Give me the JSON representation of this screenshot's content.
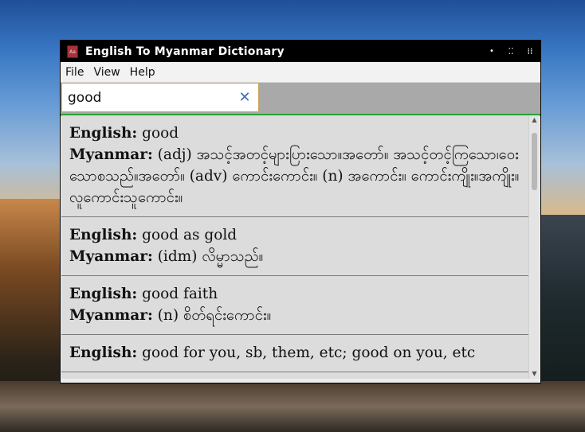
{
  "window": {
    "title": "English To Myanmar Dictionary",
    "app_icon_label": "Aa"
  },
  "menu": [
    "File",
    "View",
    "Help"
  ],
  "search": {
    "value": "good",
    "placeholder": ""
  },
  "labels": {
    "english": "English:",
    "myanmar": "Myanmar:"
  },
  "results": [
    {
      "english": "good",
      "myanmar": "(adj) အသင့်အတင့်များပြားသော။အတော်။ အသင့်တင့်ကြသော၊ဝေးသောစသည်။အတော်။ (adv) ကောင်းကောင်း။ (n) အကောင်း။ ကောင်းကျိုး။အကျိုး။ လူကောင်းသူကောင်း။"
    },
    {
      "english": "good as gold",
      "myanmar": "(idm) လိမ္မာသည်။"
    },
    {
      "english": "good faith",
      "myanmar": "(n) စိတ်ရင်းကောင်း။"
    },
    {
      "english": "good for you, sb, them, etc; good on you, etc",
      "myanmar": ""
    }
  ],
  "icons": {
    "window_controls": [
      "minimize-icon",
      "maximize-icon",
      "close-icon"
    ],
    "clear": "clear-icon"
  },
  "colors": {
    "accent": "#2aa137",
    "clear_icon": "#3b6fb6"
  }
}
